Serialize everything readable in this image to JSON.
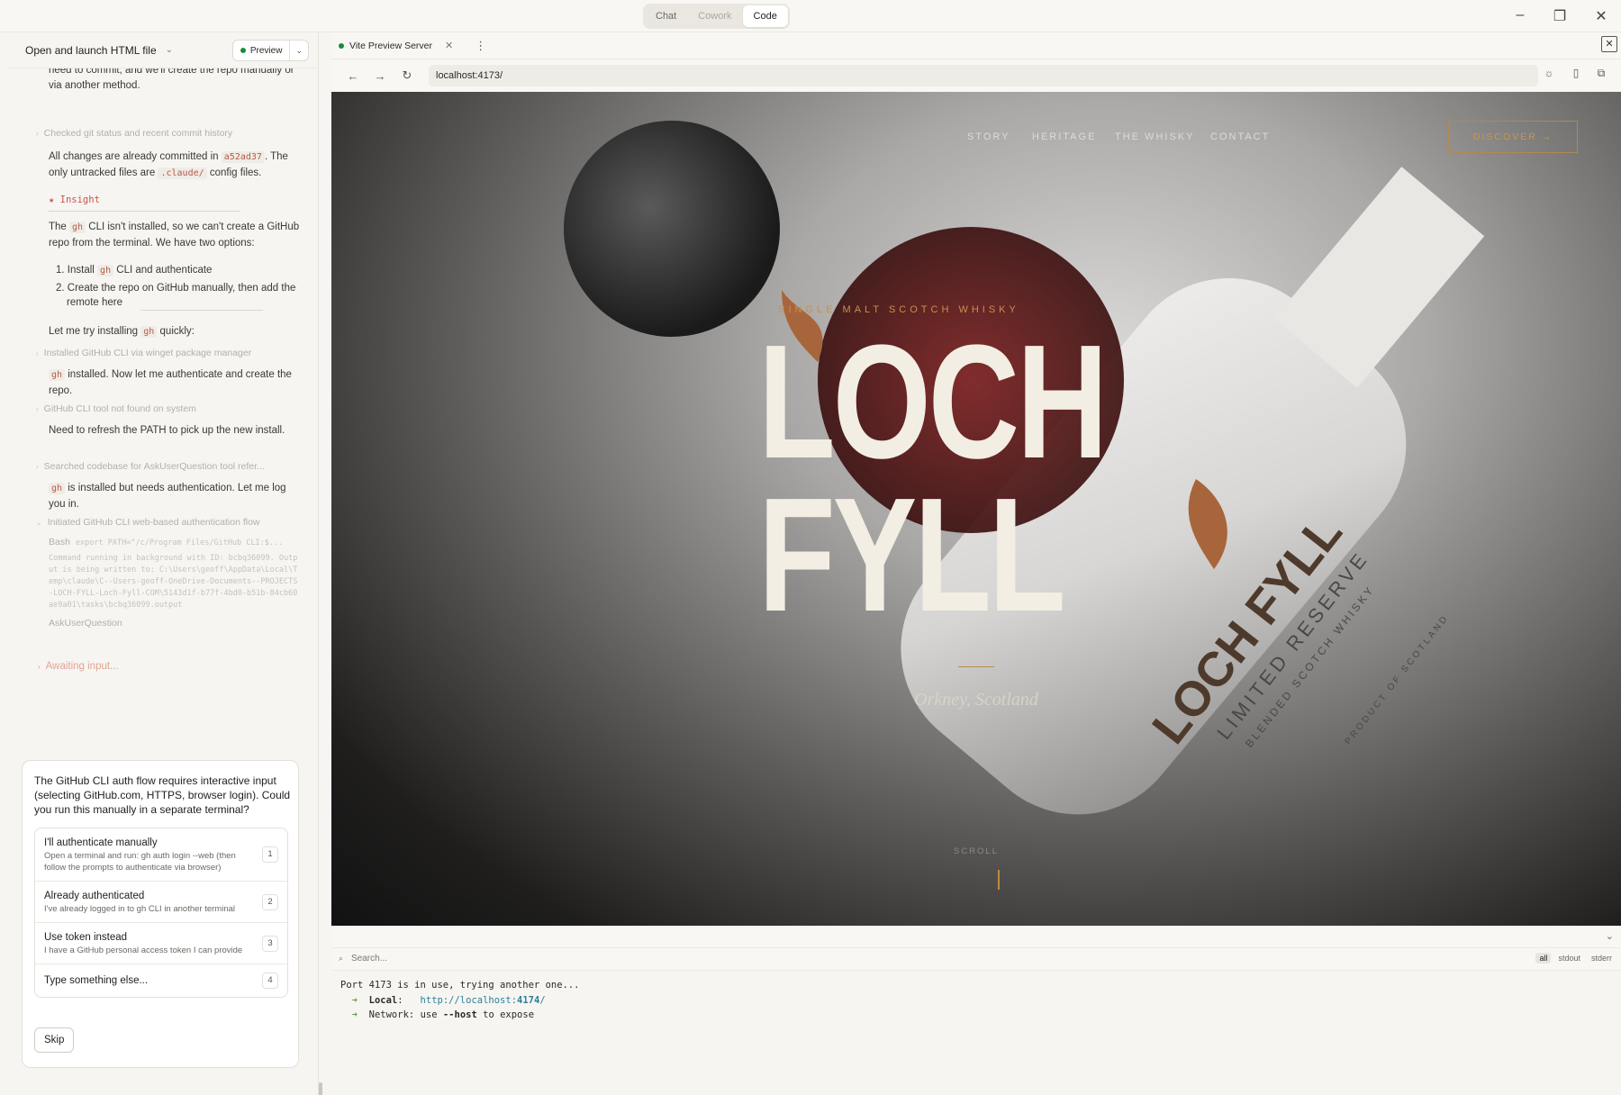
{
  "topbar": {
    "modes": [
      {
        "label": "Chat",
        "state": "normal"
      },
      {
        "label": "Cowork",
        "state": "disabled"
      },
      {
        "label": "Code",
        "state": "active"
      }
    ]
  },
  "left": {
    "title": "Open and launch HTML file",
    "preview_label": "Preview",
    "transcript": {
      "p1": "need to commit, and we'll create the repo manually or via another method.",
      "step1": "Checked git status and recent commit history",
      "p2_a": "All changes are already committed in",
      "p2_hash": "a52ad37",
      "p2_b": ". The only untracked files are",
      "p2_dir": ".claude/",
      "p2_c": "config files.",
      "insight": "★ Insight",
      "p3_a": "The",
      "p3_code": "gh",
      "p3_b": "CLI isn't installed, so we can't create a GitHub repo from the terminal. We have two options:",
      "li1_a": "Install",
      "li1_code": "gh",
      "li1_b": "CLI and authenticate",
      "li2": "Create the repo on GitHub manually, then add the remote here",
      "p4_a": "Let me try installing",
      "p4_code": "gh",
      "p4_b": "quickly:",
      "step2": "Installed GitHub CLI via winget package manager",
      "p5_code": "gh",
      "p5_b": "installed. Now let me authenticate and create the repo.",
      "step3": "GitHub CLI tool not found on system",
      "p6": "Need to refresh the PATH to pick up the new install.",
      "step4": "Searched codebase for AskUserQuestion tool refer...",
      "p7_code": "gh",
      "p7_b": "is installed but needs authentication. Let me log you in.",
      "step5": "Initiated GitHub CLI web-based authentication flow",
      "bash_label": "Bash",
      "bash_cmd": "export PATH=\"/c/Program Files/GitHub CLI:$...",
      "bash_out": "Command running in background with ID: bcbq36099. Output is being written to: C:\\Users\\geoff\\AppData\\Local\\Temp\\claude\\C--Users-geoff-OneDrive-Documents--PROJECTS-LOCH-FYLL-Loch-Fyll-COM\\5143d1f-b77f-4bd0-b51b-84cb60ae9a01\\tasks\\bcbq36099.output",
      "ask": "AskUserQuestion",
      "awaiting": "Awaiting input..."
    },
    "question": {
      "text": "The GitHub CLI auth flow requires interactive input (selecting GitHub.com, HTTPS, browser login). Could you run this manually in a separate terminal?",
      "options": [
        {
          "label": "I'll authenticate manually",
          "desc": "Open a terminal and run: gh auth login --web (then follow the prompts to authenticate via browser)",
          "num": "1"
        },
        {
          "label": "Already authenticated",
          "desc": "I've already logged in to gh CLI in another terminal",
          "num": "2"
        },
        {
          "label": "Use token instead",
          "desc": "I have a GitHub personal access token I can provide",
          "num": "3"
        },
        {
          "label": "Type something else...",
          "desc": "",
          "num": "4"
        }
      ],
      "skip": "Skip"
    }
  },
  "right": {
    "tab_label": "Vite Preview Server",
    "url": "localhost:4173/",
    "site": {
      "nav": [
        "STORY",
        "HERITAGE",
        "THE WHISKY",
        "CONTACT"
      ],
      "cta": "DISCOVER  →",
      "eyebrow": "SINGLE MALT SCOTCH WHISKY",
      "brand_line1": "LOCH",
      "brand_line2": "FYLL",
      "place": "Orkney, Scotland",
      "scroll": "SCROLL",
      "bottle_label_1": "LOCH FYLL",
      "bottle_label_2": "LIMITED RESERVE",
      "bottle_label_3": "BLENDED SCOTCH WHISKY",
      "bottle_label_4": "PRODUCT OF SCOTLAND"
    },
    "console": {
      "search_placeholder": "Search...",
      "filters": [
        {
          "label": "all",
          "active": true
        },
        {
          "label": "stdout",
          "active": false
        },
        {
          "label": "stderr",
          "active": false
        }
      ],
      "line1": "Port 4173 is in use, trying another one...",
      "local_label": "Local",
      "local_url_a": "http://localhost:",
      "local_url_port": "4174",
      "local_url_b": "/",
      "network_label": "Network",
      "network_a": "use",
      "network_flag": "--host",
      "network_b": "to expose"
    }
  }
}
